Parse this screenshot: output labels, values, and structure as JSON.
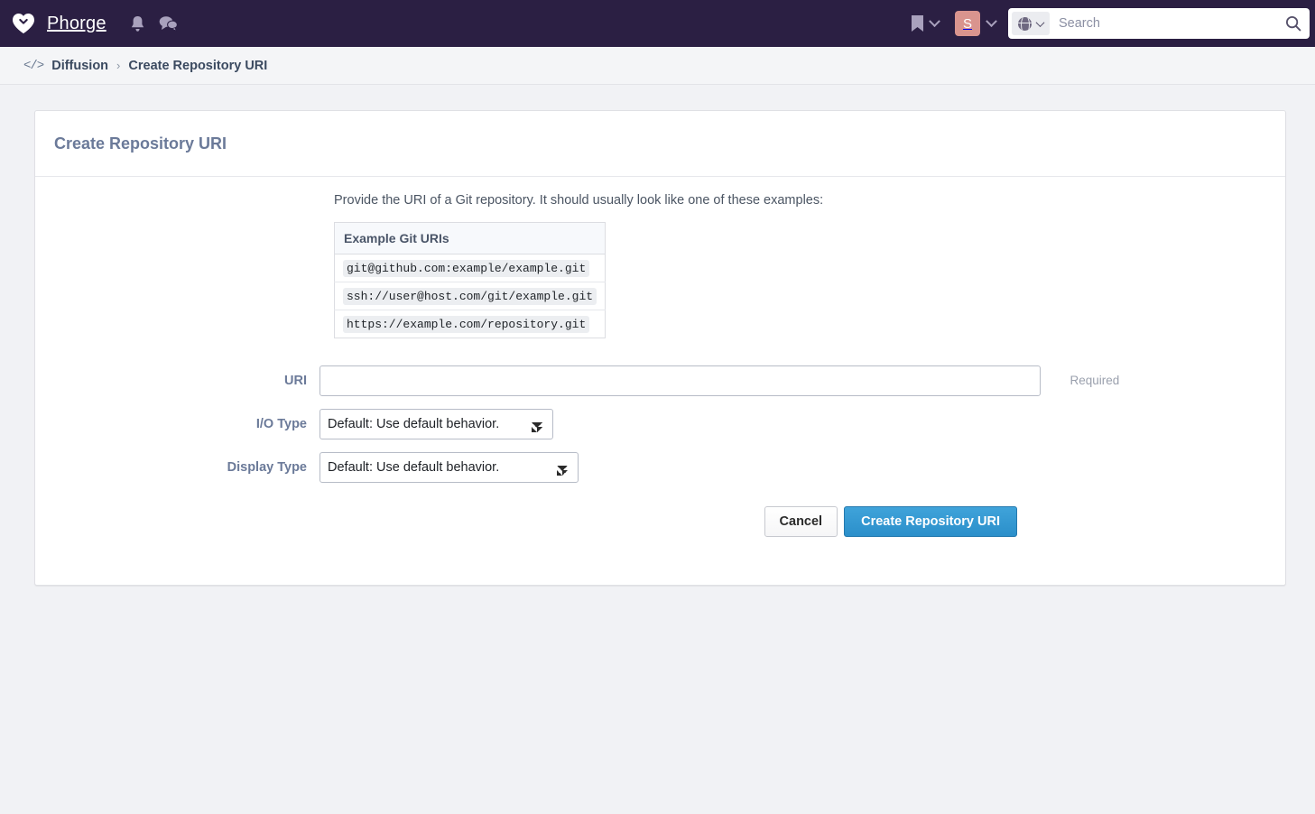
{
  "nav": {
    "brand": "Phorge",
    "logo_icon": "heart-logo-icon",
    "bell_icon": "bell-icon",
    "chat_icon": "chat-bubbles-icon",
    "bookmark_icon": "bookmark-icon",
    "avatar_initial": "S",
    "scope_icon": "globe-icon",
    "search_placeholder": "Search",
    "search_value": "",
    "search_icon": "magnifier-icon",
    "bg_color": "#2b1f43",
    "avatar_color": "#d9948e"
  },
  "breadcrumb": {
    "app_icon": "</>",
    "app": "Diffusion",
    "separator": "›",
    "current": "Create Repository URI"
  },
  "panel": {
    "title": "Create Repository URI",
    "intro": "Provide the URI of a Git repository. It should usually look like one of these examples:",
    "examples_table": {
      "header": "Example Git URIs",
      "rows": [
        "git@github.com:example/example.git",
        "ssh://user@host.com/git/example.git",
        "https://example.com/repository.git"
      ]
    },
    "form": {
      "uri": {
        "label": "URI",
        "value": "",
        "placeholder": "",
        "note": "Required"
      },
      "io_type": {
        "label": "I/O Type",
        "selected": "Default: Use default behavior.",
        "options": [
          "Default: Use default behavior."
        ]
      },
      "display_type": {
        "label": "Display Type",
        "selected": "Default: Use default behavior.",
        "options": [
          "Default: Use default behavior."
        ]
      }
    },
    "buttons": {
      "cancel": "Cancel",
      "submit": "Create Repository URI",
      "submit_color": "#2b8fca"
    }
  }
}
